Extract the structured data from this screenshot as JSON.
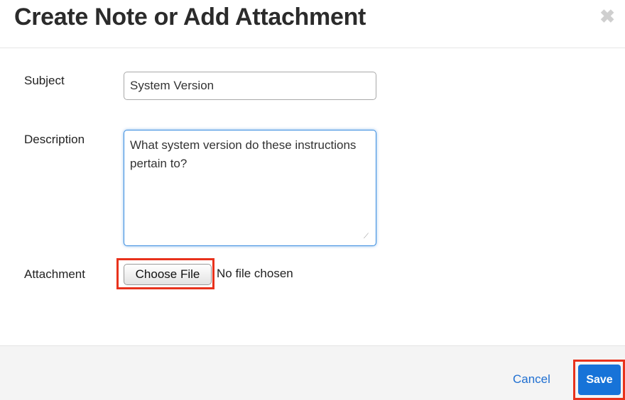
{
  "dialog": {
    "title": "Create Note or Add Attachment",
    "close_glyph": "✖"
  },
  "form": {
    "subject_label": "Subject",
    "subject_value": "System Version",
    "description_label": "Description",
    "description_value": "What system version do these instructions pertain to?",
    "attachment_label": "Attachment",
    "choose_file_label": "Choose File",
    "no_file_text": "No file chosen"
  },
  "footer": {
    "cancel_label": "Cancel",
    "save_label": "Save"
  },
  "colors": {
    "accent": "#1773d8",
    "highlight": "#e8321c",
    "link": "#1f6fd1"
  }
}
